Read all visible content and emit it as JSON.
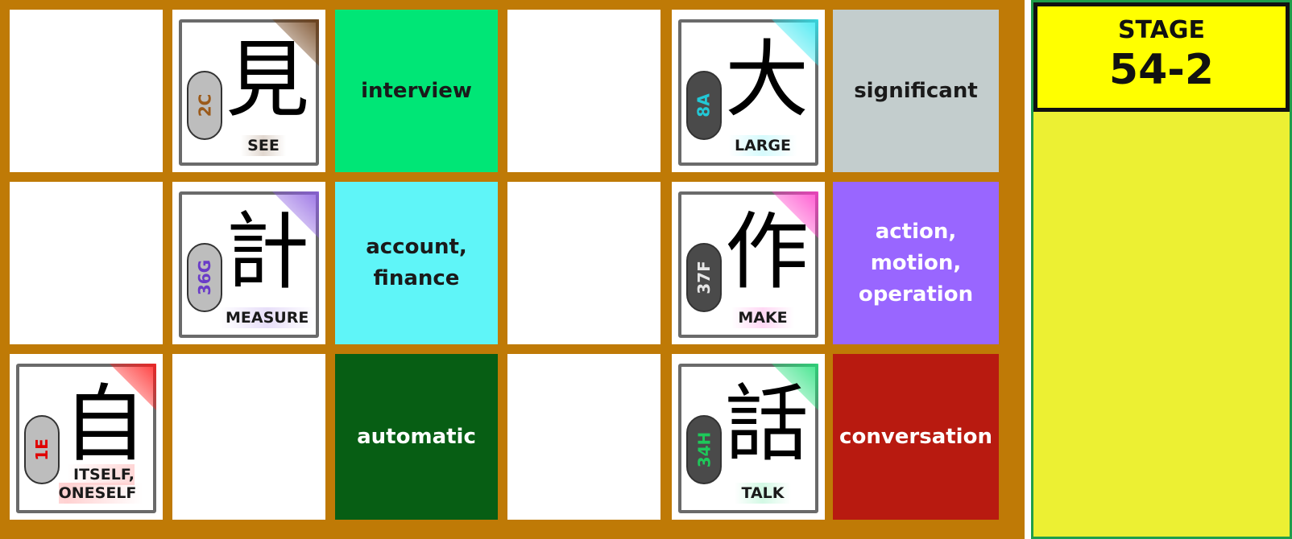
{
  "stage": {
    "label": "STAGE",
    "number": "54-2"
  },
  "colors": {
    "board": "#bf7a06",
    "side_panel": "#ecf033",
    "stage_box": "#ffff00"
  },
  "cards": [
    {
      "kind": "kanji",
      "row": 0,
      "col": 1,
      "kanji": "見",
      "code": "2C",
      "meaning": "SEE",
      "code_color": "#9b5a1a",
      "accent": "#6b3a10",
      "brain": "light"
    },
    {
      "kind": "word",
      "row": 0,
      "col": 2,
      "text": "interview",
      "bg": "#00e676",
      "light": false
    },
    {
      "kind": "kanji",
      "row": 0,
      "col": 4,
      "kanji": "大",
      "code": "8A",
      "meaning": "LARGE",
      "code_color": "#22c8d6",
      "accent": "#2ee6f0",
      "brain": "dark"
    },
    {
      "kind": "word",
      "row": 0,
      "col": 5,
      "text": "significant",
      "bg": "#c3cdcd",
      "light": false
    },
    {
      "kind": "kanji",
      "row": 1,
      "col": 1,
      "kanji": "計",
      "code": "36G",
      "meaning": "MEASURE",
      "code_color": "#6a3cc8",
      "accent": "#8a5ce0",
      "brain": "light"
    },
    {
      "kind": "word",
      "row": 1,
      "col": 2,
      "text": "account,\nfinance",
      "bg": "#5ff5f8",
      "light": false
    },
    {
      "kind": "kanji",
      "row": 1,
      "col": 4,
      "kanji": "作",
      "code": "37F",
      "meaning": "MAKE",
      "code_color": "#e6e6e6",
      "accent": "#ff3cc8",
      "brain": "dark"
    },
    {
      "kind": "word",
      "row": 1,
      "col": 5,
      "text": "action,\nmotion,\noperation",
      "bg": "#9966ff",
      "light": true
    },
    {
      "kind": "kanji",
      "row": 2,
      "col": 0,
      "kanji": "自",
      "code": "1E",
      "meaning": "ITSELF,\nONESELF",
      "code_color": "#e00000",
      "accent": "#ff1a1a",
      "brain": "light"
    },
    {
      "kind": "word",
      "row": 2,
      "col": 2,
      "text": "automatic",
      "bg": "#075e14",
      "light": true
    },
    {
      "kind": "kanji",
      "row": 2,
      "col": 4,
      "kanji": "話",
      "code": "34H",
      "meaning": "TALK",
      "code_color": "#1ec85a",
      "accent": "#22e07a",
      "brain": "dark"
    },
    {
      "kind": "word",
      "row": 2,
      "col": 5,
      "text": "conversation",
      "bg": "#b81a10",
      "light": true
    }
  ]
}
